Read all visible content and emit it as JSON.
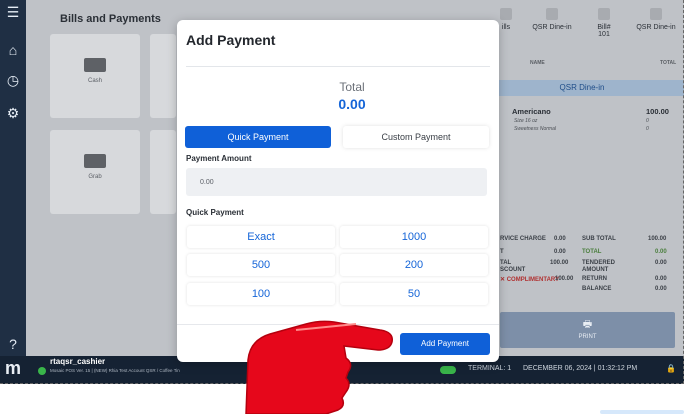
{
  "page": {
    "section_title": "Bills and Payments"
  },
  "payment_methods": [
    {
      "label": "Cash"
    },
    {
      "label": "Grab"
    }
  ],
  "right_panel": {
    "header": [
      {
        "label": "ills"
      },
      {
        "label": "QSR Dine-in"
      },
      {
        "label": "Bill#\n101"
      },
      {
        "label": "QSR Dine-in"
      }
    ],
    "subheads": [
      "NAME",
      "TOTAL"
    ],
    "band": "QSR Dine-in",
    "item": {
      "name": "Americano",
      "price": "100.00",
      "mod1": "Size 16 oz",
      "mod1_val": "0",
      "mod2": "Sweetness Normal",
      "mod2_val": "0"
    },
    "totals_left": [
      {
        "label": "RVICE CHARGE",
        "value": "0.00"
      },
      {
        "label": "T",
        "value": "0.00"
      },
      {
        "label": "TAL\nSCOUNT",
        "value": "100.00"
      },
      {
        "label": "✕ COMPLIMENTARY",
        "value": "100.00"
      }
    ],
    "totals_right": [
      {
        "label": "SUB TOTAL",
        "value": "100.00"
      },
      {
        "label": "TOTAL",
        "value": "0.00"
      },
      {
        "label": "TENDERED AMOUNT",
        "value": "0.00"
      },
      {
        "label": "RETURN",
        "value": "0.00"
      },
      {
        "label": "BALANCE",
        "value": "0.00"
      }
    ],
    "print_label": "PRINT"
  },
  "modal": {
    "title": "Add Payment",
    "total_label": "Total",
    "total_value": "0.00",
    "tabs": {
      "quick": "Quick Payment",
      "custom": "Custom Payment"
    },
    "amount_label": "Payment Amount",
    "amount_value": "0.00",
    "quick_label": "Quick Payment",
    "quick_buttons": [
      "Exact",
      "1000",
      "500",
      "200",
      "100",
      "50"
    ],
    "add_button": "Add Payment"
  },
  "status_bar": {
    "user": "rtaqsr_cashier",
    "version": "Mosaic POS Ver. 15 | (NEW) Rhia Test Account QSR / Coffee Tin",
    "terminal": "TERMINAL: 1",
    "datetime": "DECEMBER 06, 2024 | 01:32:12 PM"
  },
  "colors": {
    "primary": "#0f60d8",
    "sidebar": "#1f2f44",
    "status_bar": "#152233",
    "hand": "#e6071b"
  }
}
